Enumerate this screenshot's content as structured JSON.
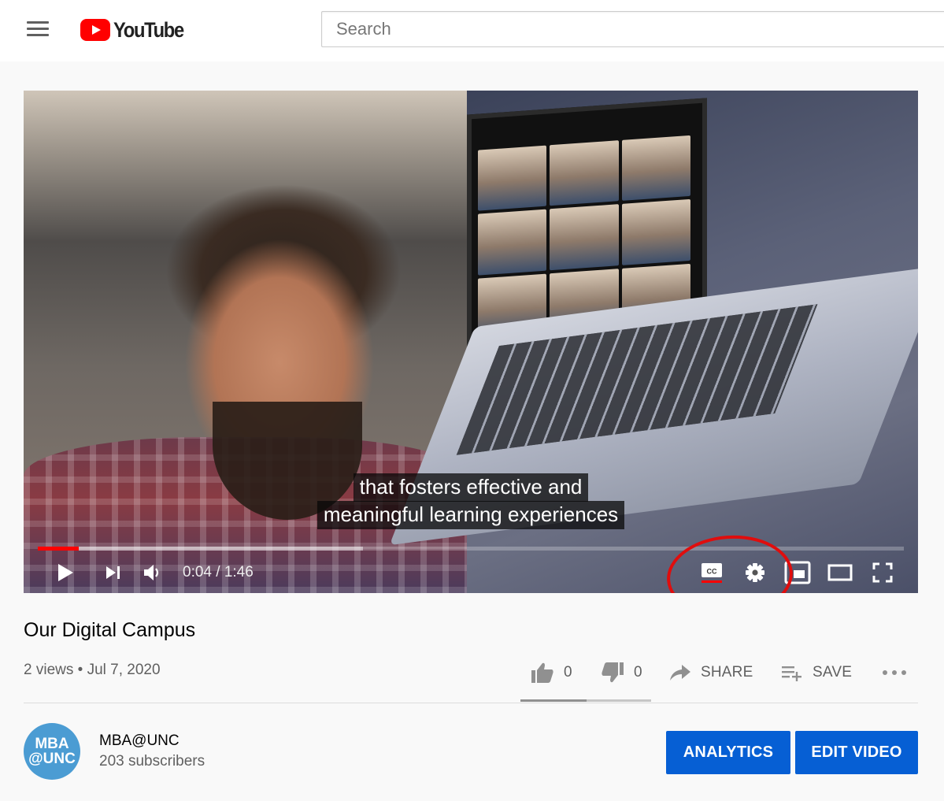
{
  "header": {
    "logo_text": "YouTube",
    "search_placeholder": "Search"
  },
  "player": {
    "captions": [
      "that fosters effective and",
      "meaningful learning experiences"
    ],
    "time_current": "0:04",
    "time_separator": " / ",
    "time_total": "1:46",
    "played_fraction": 0.047,
    "buffered_fraction": 0.375,
    "progress_color": "#ff0000",
    "cc_active": true,
    "annotation_color": "#e00d0d"
  },
  "video": {
    "title": "Our Digital Campus",
    "views": "2 views",
    "bullet": " • ",
    "date": "Jul 7, 2020"
  },
  "actions": {
    "likes": "0",
    "dislikes": "0",
    "share_label": "SHARE",
    "save_label": "SAVE"
  },
  "channel": {
    "avatar_line1": "MBA",
    "avatar_line2": "@UNC",
    "avatar_color": "#4b9cd3",
    "name": "MBA@UNC",
    "subscribers": "203 subscribers",
    "analytics_label": "ANALYTICS",
    "edit_label": "EDIT VIDEO",
    "button_color": "#065fd4"
  }
}
